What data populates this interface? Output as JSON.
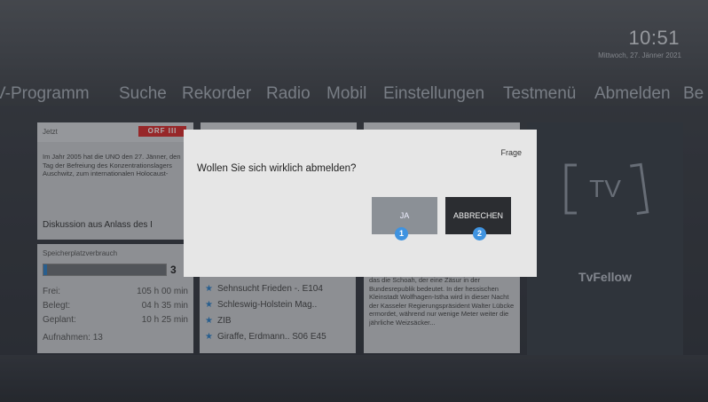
{
  "clock": {
    "time": "10:51",
    "date": "Mittwoch, 27. Jänner 2021"
  },
  "menu": [
    {
      "label": "V-Programm"
    },
    {
      "label": "Suche"
    },
    {
      "label": "Rekorder"
    },
    {
      "label": "Radio"
    },
    {
      "label": "Mobil"
    },
    {
      "label": "Einstellungen"
    },
    {
      "label": "Testmenü"
    },
    {
      "label": "Abmelden"
    },
    {
      "label": "Be"
    }
  ],
  "now_tile": {
    "header": "Jetzt",
    "channel_logo": "ORF III",
    "text": "Im Jahr 2005 hat die UNO den 27. Jänner, den Tag der Befreiung des Konzentrationslagers Auschwitz, zum internationalen Holocaust-",
    "subtitle": "Diskussion aus Anlass des I"
  },
  "storage": {
    "label": "Speicherplatzverbrauch",
    "percent_text": "3",
    "fill_fraction": 0.03,
    "rows": [
      {
        "label": "Frei:",
        "value": "105 h 00 min"
      },
      {
        "label": "Belegt:",
        "value": "04 h 35 min"
      },
      {
        "label": "Geplant:",
        "value": "10 h 25 min"
      }
    ],
    "recordings": "Aufnahmen: 13"
  },
  "recordings": [
    {
      "title": "Sehnsucht Frieden -. E104"
    },
    {
      "title": "Schleswig-Holstein Mag.."
    },
    {
      "title": "ZIB"
    },
    {
      "title": "Giraffe, Erdmann.. S06 E45"
    }
  ],
  "text_tile": {
    "text": "das die Schoah, der eine Zäsur in der Bundesrepublik bedeutet. In der hessischen Kleinstadt Wolfhagen-Istha wird in dieser Nacht der Kasseler Regierungspräsident Walter Lübcke ermordet, während nur wenige Meter weiter die jährliche Weizsäcker..."
  },
  "tvfellow": {
    "mark": "TV",
    "label": "TvFellow"
  },
  "dialog": {
    "title": "Frage",
    "question": "Wollen Sie sich wirklich abmelden?",
    "yes_label": "JA",
    "yes_badge": "1",
    "cancel_label": "ABBRECHEN",
    "cancel_badge": "2"
  },
  "colors": {
    "accent": "#3f93e0",
    "orf_red": "#d92b2b",
    "dialog_bg": "#e6e6e6"
  }
}
